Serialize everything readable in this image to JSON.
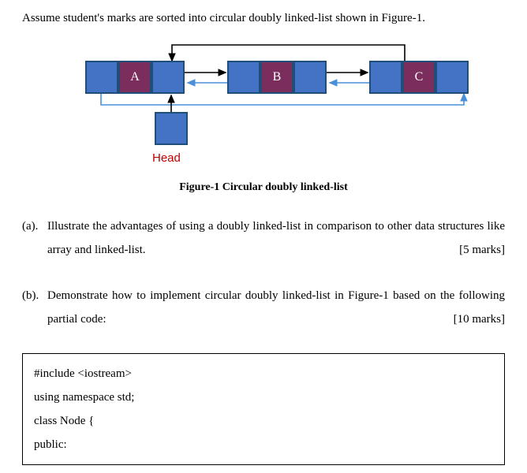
{
  "intro": "Assume student's marks are sorted into circular doubly linked-list shown in Figure-1.",
  "nodes": {
    "a": "A",
    "b": "B",
    "c": "C"
  },
  "head_label": "Head",
  "figure_caption": "Figure-1 Circular doubly linked-list",
  "qa": {
    "label": "(a).",
    "text": "Illustrate the advantages of using a doubly linked-list in comparison to other data structures like array and linked-list.",
    "marks": "[5 marks]"
  },
  "qb": {
    "label": "(b).",
    "text": "Demonstrate how to implement circular doubly linked-list in Figure-1 based on the following partial code:",
    "marks": "[10 marks]"
  },
  "code": {
    "l1": "#include <iostream>",
    "l2": "using namespace std;",
    "l3": "class Node {",
    "l4": "public:"
  }
}
